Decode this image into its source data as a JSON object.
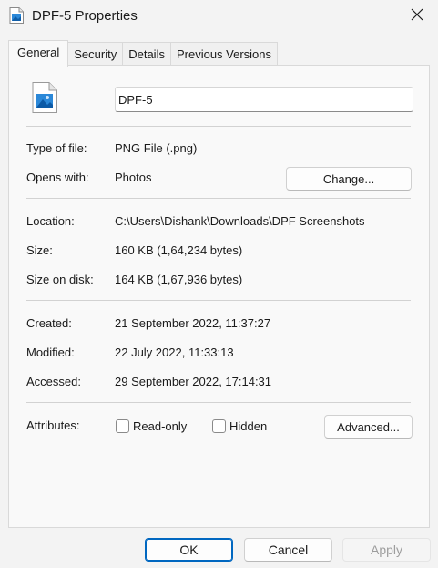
{
  "window": {
    "title": "DPF-5 Properties"
  },
  "tabs": [
    {
      "label": "General",
      "active": true
    },
    {
      "label": "Security",
      "active": false
    },
    {
      "label": "Details",
      "active": false
    },
    {
      "label": "Previous Versions",
      "active": false
    }
  ],
  "general": {
    "file_name": "DPF-5",
    "type_label": "Type of file:",
    "type_value": "PNG File (.png)",
    "opens_label": "Opens with:",
    "opens_value": "Photos",
    "change_label": "Change...",
    "location_label": "Location:",
    "location_value": "C:\\Users\\Dishank\\Downloads\\DPF Screenshots",
    "size_label": "Size:",
    "size_value": "160 KB (1,64,234 bytes)",
    "size_disk_label": "Size on disk:",
    "size_disk_value": "164 KB (1,67,936 bytes)",
    "created_label": "Created:",
    "created_value": "21 September 2022, 11:37:27",
    "modified_label": "Modified:",
    "modified_value": "22 July 2022, 11:33:13",
    "accessed_label": "Accessed:",
    "accessed_value": "29 September 2022, 17:14:31",
    "attributes_label": "Attributes:",
    "readonly_label": "Read-only",
    "readonly_checked": false,
    "hidden_label": "Hidden",
    "hidden_checked": false,
    "advanced_label": "Advanced..."
  },
  "footer": {
    "ok_label": "OK",
    "cancel_label": "Cancel",
    "apply_label": "Apply"
  },
  "colors": {
    "accent": "#0067c0",
    "image_icon_blue": "#2b88d8"
  },
  "icons": {
    "title_icon": "image-file-icon",
    "close_icon": "close-icon",
    "file_icon": "image-file-icon"
  }
}
